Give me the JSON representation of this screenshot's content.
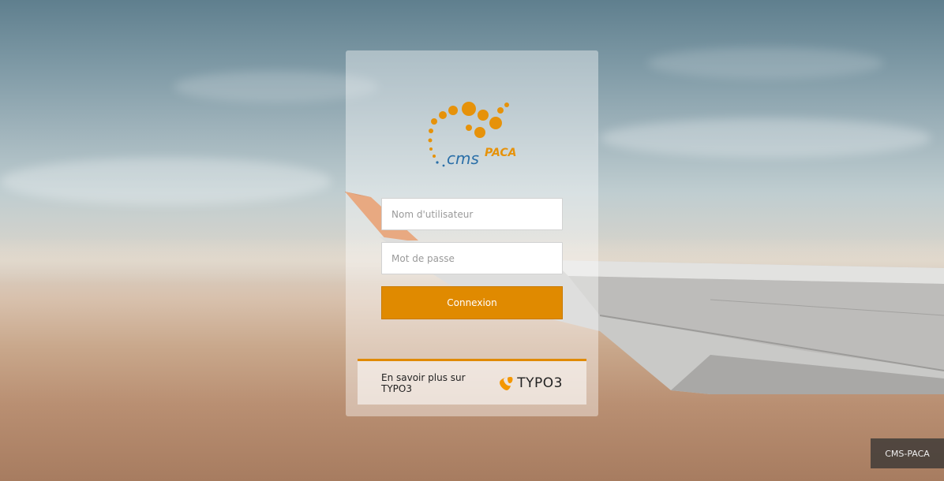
{
  "background": {
    "description_icon": "airplane-wing-over-desert-photo"
  },
  "login": {
    "logo_text": "cms PACA",
    "username_placeholder": "Nom d'utilisateur",
    "password_placeholder": "Mot de passe",
    "submit_label": "Connexion",
    "footer_link": "En savoir plus sur TYPO3",
    "footer_logo": "TYPO3"
  },
  "site_badge": "CMS-PACA",
  "colors": {
    "accent": "#e08a00",
    "logo_blue": "#2a6fa8"
  }
}
